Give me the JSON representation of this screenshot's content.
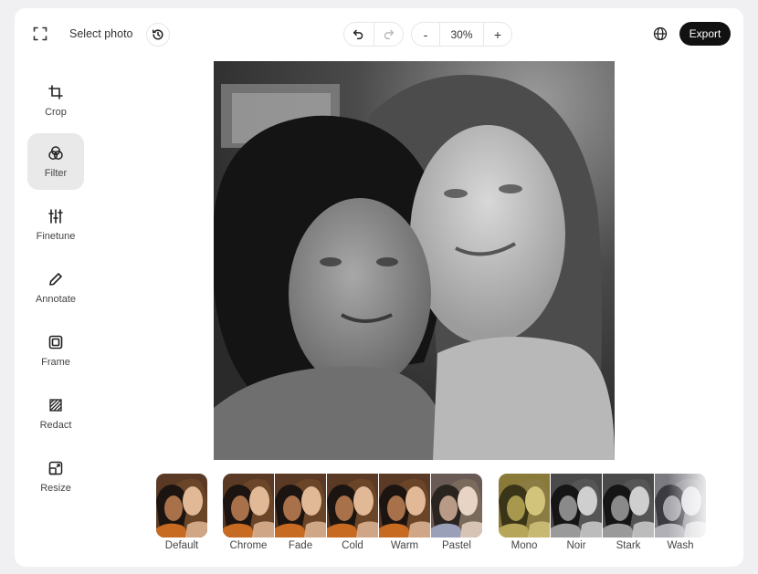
{
  "topbar": {
    "select_photo_label": "Select photo",
    "zoom_value": "30%",
    "zoom_minus": "-",
    "zoom_plus": "+",
    "export_label": "Export",
    "icons": [
      "fullscreen-icon",
      "history-icon",
      "undo-icon",
      "redo-icon",
      "globe-icon"
    ]
  },
  "sidebar": {
    "tools": [
      {
        "label": "Crop",
        "icon": "crop-icon",
        "active": false
      },
      {
        "label": "Filter",
        "icon": "filter-icon",
        "active": true
      },
      {
        "label": "Finetune",
        "icon": "sliders-icon",
        "active": false
      },
      {
        "label": "Annotate",
        "icon": "pencil-icon",
        "active": false
      },
      {
        "label": "Frame",
        "icon": "frame-icon",
        "active": false
      },
      {
        "label": "Redact",
        "icon": "redact-icon",
        "active": false
      },
      {
        "label": "Resize",
        "icon": "resize-icon",
        "active": false
      }
    ]
  },
  "filters": [
    {
      "label": "Default",
      "group": 1,
      "tint": "color"
    },
    {
      "label": "Chrome",
      "group": 2,
      "tint": "color"
    },
    {
      "label": "Fade",
      "group": 2,
      "tint": "color"
    },
    {
      "label": "Cold",
      "group": 2,
      "tint": "color"
    },
    {
      "label": "Warm",
      "group": 2,
      "tint": "color"
    },
    {
      "label": "Pastel",
      "group": 2,
      "tint": "pastel"
    },
    {
      "label": "Mono",
      "group": 3,
      "tint": "sepia"
    },
    {
      "label": "Noir",
      "group": 3,
      "tint": "bw"
    },
    {
      "label": "Stark",
      "group": 3,
      "tint": "bw"
    },
    {
      "label": "Wash",
      "group": 3,
      "tint": "wash"
    }
  ],
  "colors": {
    "export_bg": "#111111",
    "active_tool_bg": "#e9e9ea",
    "app_bg": "#ffffff",
    "page_bg": "#f0f0f2"
  }
}
